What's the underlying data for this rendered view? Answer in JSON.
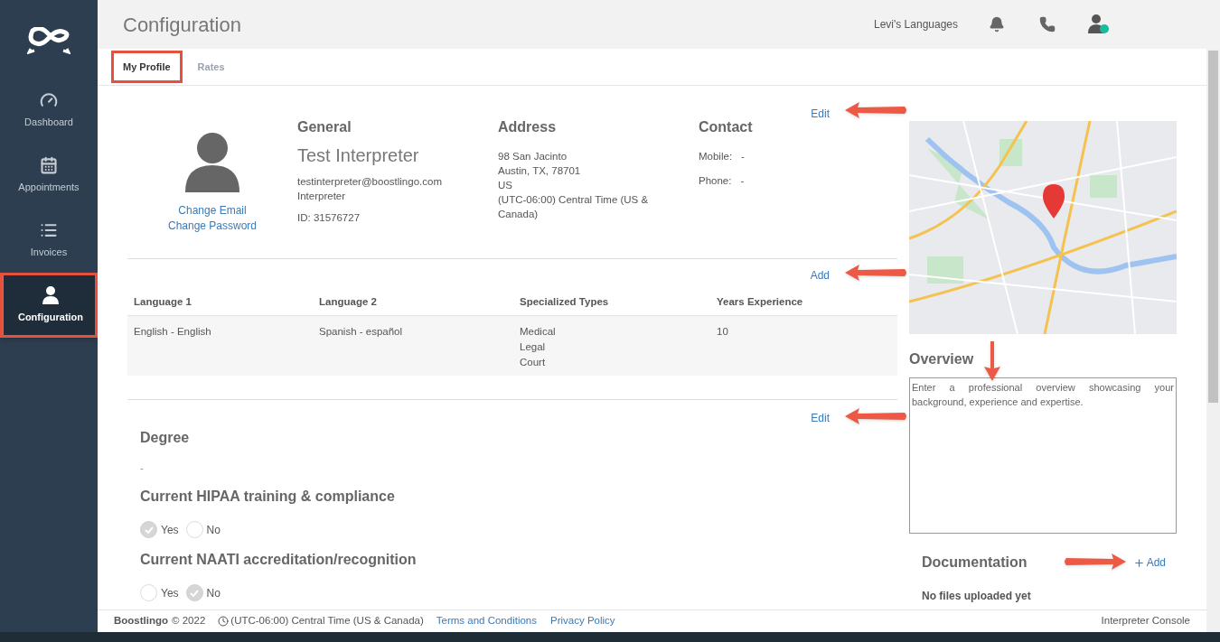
{
  "sidebar": {
    "items": [
      {
        "label": "Dashboard",
        "kind": "dashboard",
        "selected": false,
        "annotated": false
      },
      {
        "label": "Appointments",
        "kind": "calendar",
        "selected": false,
        "annotated": false
      },
      {
        "label": "Invoices",
        "kind": "list",
        "selected": false,
        "annotated": false
      },
      {
        "label": "Configuration",
        "kind": "user",
        "selected": true,
        "annotated": true
      }
    ]
  },
  "header": {
    "title": "Configuration",
    "organization": "Levi's Languages"
  },
  "tabs": [
    {
      "label": "My Profile",
      "selected": true,
      "annotated": true
    },
    {
      "label": "Rates",
      "selected": false,
      "annotated": false
    }
  ],
  "profile": {
    "edit_link": "Edit",
    "links": [
      "Change Email",
      "Change Password"
    ],
    "general": {
      "heading": "General",
      "name": "Test Interpreter",
      "lines": [
        "testinterpreter@boostlingo.com",
        "Interpreter"
      ],
      "id": "ID: 31576727"
    },
    "address": {
      "heading": "Address",
      "lines": [
        "98 San Jacinto",
        "Austin, TX, 78701",
        "US",
        "(UTC-06:00) Central Time (US & Canada)"
      ]
    },
    "contact": {
      "heading": "Contact",
      "rows": [
        {
          "label": "Mobile:",
          "value": "-"
        },
        {
          "label": "Phone:",
          "value": "-"
        }
      ]
    }
  },
  "languages": {
    "add_link": "Add",
    "columns": [
      "Language 1",
      "Language 2",
      "Specialized Types",
      "Years Experience"
    ],
    "rows": [
      [
        [
          "English - English"
        ],
        [
          "Spanish - español"
        ],
        [
          "Medical",
          "Legal",
          "Court"
        ],
        [
          "10"
        ]
      ]
    ]
  },
  "qualifications": {
    "edit_link": "Edit",
    "degree": {
      "heading": "Degree",
      "value": "-"
    },
    "questions": [
      {
        "heading": "Current HIPAA training & compliance",
        "options": [
          {
            "label": "Yes",
            "selected": true
          },
          {
            "label": "No",
            "selected": false
          }
        ]
      },
      {
        "heading": "Current NAATI accreditation/recognition",
        "options": [
          {
            "label": "Yes",
            "selected": false
          },
          {
            "label": "No",
            "selected": true
          }
        ]
      }
    ]
  },
  "overview": {
    "heading": "Overview",
    "placeholder": "Enter a professional overview showcasing your background, experience and expertise."
  },
  "documentation": {
    "heading": "Documentation",
    "add_link": "Add",
    "empty": "No files uploaded yet"
  },
  "footer": {
    "brand": "Boostlingo",
    "copyright": "© 2022",
    "timezone": "(UTC-06:00) Central Time (US & Canada)",
    "links": [
      "Terms and Conditions",
      "Privacy Policy"
    ],
    "console": "Interpreter Console"
  }
}
